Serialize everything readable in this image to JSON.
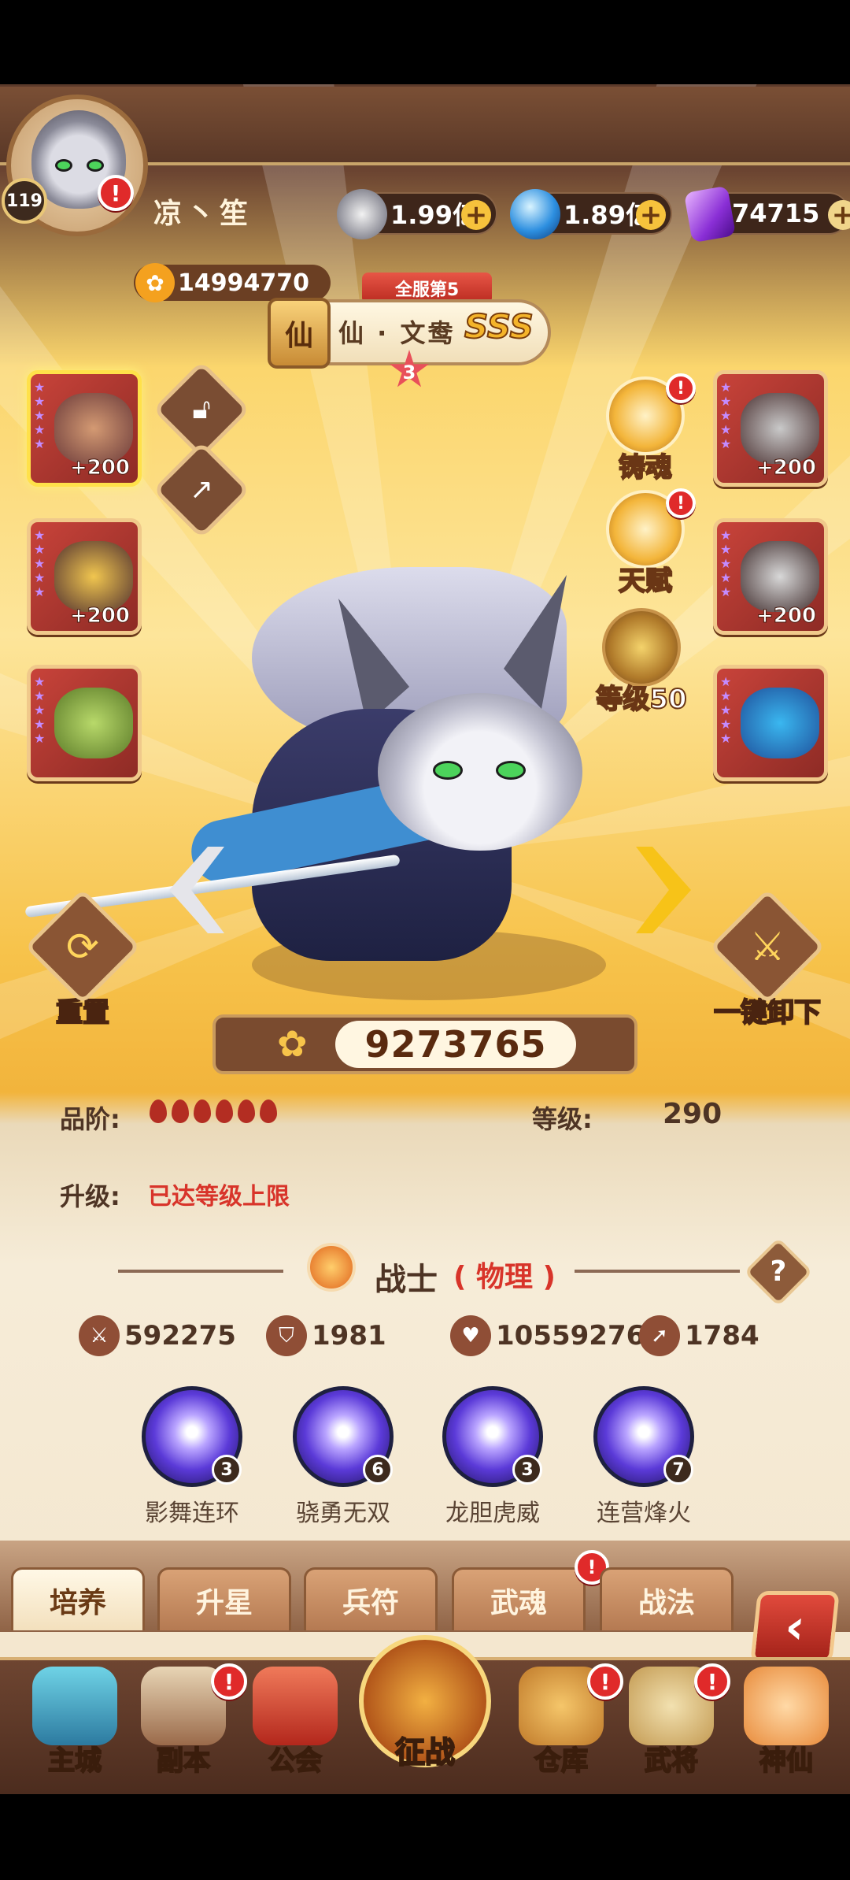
{
  "player": {
    "level": "119",
    "name": "凉丶笙",
    "power": "14994770"
  },
  "currencies": {
    "coins": "1.99亿",
    "gems": "1.89亿",
    "crystals": "74715"
  },
  "hero": {
    "server_rank": "全服第5",
    "faction_mark": "仙",
    "name": "仙 · 文鸯",
    "rarity": "SSS",
    "stars": "3",
    "combat_power": "9273765"
  },
  "equipment_left": [
    {
      "bonus": "+200"
    },
    {
      "bonus": "+200"
    },
    {
      "bonus": ""
    }
  ],
  "equipment_right": [
    {
      "bonus": "+200"
    },
    {
      "bonus": "+200"
    },
    {
      "bonus": ""
    }
  ],
  "features": {
    "soul_cast": "铸魂",
    "talent": "天赋",
    "level_gate": "等级50"
  },
  "actions": {
    "reset": "重置",
    "unequip_all": "一键卸下"
  },
  "info": {
    "grade_label": "品阶:",
    "grade_count": 6,
    "level_label": "等级:",
    "level_value": "290",
    "upgrade_label": "升级:",
    "upgrade_status": "已达等级上限"
  },
  "class": {
    "name": "战士",
    "type": "( 物理 )"
  },
  "stats": {
    "attack": "592275",
    "defense": "1981",
    "hp": "10559276",
    "speed": "1784"
  },
  "skills": [
    {
      "name": "影舞连环",
      "level": "3"
    },
    {
      "name": "骁勇无双",
      "level": "6"
    },
    {
      "name": "龙胆虎威",
      "level": "3"
    },
    {
      "name": "连营烽火",
      "level": "7"
    }
  ],
  "tabs": [
    "培养",
    "升星",
    "兵符",
    "武魂",
    "战法"
  ],
  "nav": {
    "main_city": "主城",
    "dungeon": "副本",
    "guild": "公会",
    "battle": "征战",
    "warehouse": "仓库",
    "generals": "武将",
    "immortal": "神仙"
  },
  "colors": {
    "accent_red": "#d8342a",
    "panel_brown": "#4e3424",
    "gold": "#f7c318"
  }
}
